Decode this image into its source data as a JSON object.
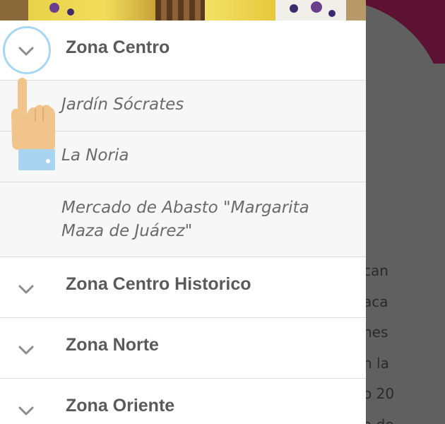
{
  "background_text_lines": [
    "can",
    "aca",
    "nes",
    "n la",
    "o 20",
    "a de"
  ],
  "zones": [
    {
      "label": "Zona Centro",
      "expanded": true,
      "items": [
        {
          "label": "Jardín Sócrates"
        },
        {
          "label": "La Noria"
        },
        {
          "label_line1": "Mercado de Abasto \"Margarita",
          "label_line2": "Maza  de Juárez\""
        }
      ]
    },
    {
      "label": "Zona Centro Historico",
      "expanded": false
    },
    {
      "label": "Zona Norte",
      "expanded": false
    },
    {
      "label": "Zona Oriente",
      "expanded": false
    }
  ],
  "icons": {
    "chevron": "chevron-down-icon",
    "pointer": "tap-hand-icon"
  },
  "colors": {
    "header_text": "#5a5a5a",
    "item_text": "#6a6a6a",
    "chevron": "#8c8c8c",
    "focus_ring": "#a7d7f2",
    "overlay": "#606060",
    "maroon": "#5e1233"
  }
}
